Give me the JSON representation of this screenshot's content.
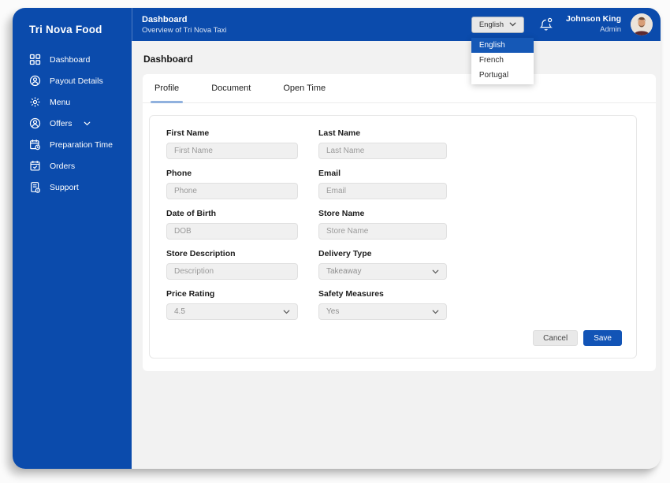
{
  "app": {
    "name": "Tri Nova Food"
  },
  "sidebar": {
    "items": [
      {
        "icon": "grid-icon",
        "label": "Dashboard"
      },
      {
        "icon": "user-circle-icon",
        "label": "Payout Details"
      },
      {
        "icon": "gear-icon",
        "label": "Menu"
      },
      {
        "icon": "user-circle-icon",
        "label": "Offers",
        "has_submenu": true
      },
      {
        "icon": "calendar-clock-icon",
        "label": "Preparation Time"
      },
      {
        "icon": "calendar-check-icon",
        "label": "Orders"
      },
      {
        "icon": "support-doc-icon",
        "label": "Support"
      }
    ]
  },
  "header": {
    "title": "Dashboard",
    "subtitle": "Overview of Tri Nova Taxi",
    "language": {
      "selected": "English",
      "options": [
        "English",
        "French",
        "Portugal"
      ],
      "active_option": "English"
    },
    "notifications_icon": "bell-icon",
    "user": {
      "name": "Johnson King",
      "role": "Admin"
    }
  },
  "main": {
    "heading": "Dashboard",
    "tabs": [
      {
        "label": "Profile",
        "active": true
      },
      {
        "label": "Document",
        "active": false
      },
      {
        "label": "Open Time",
        "active": false
      }
    ],
    "form": {
      "fields": [
        {
          "label": "First Name",
          "type": "input",
          "placeholder": "First Name"
        },
        {
          "label": "Last Name",
          "type": "input",
          "placeholder": "Last Name"
        },
        {
          "label": "Phone",
          "type": "input",
          "placeholder": "Phone"
        },
        {
          "label": "Email",
          "type": "input",
          "placeholder": "Email"
        },
        {
          "label": "Date of Birth",
          "type": "input",
          "placeholder": "DOB"
        },
        {
          "label": "Store Name",
          "type": "input",
          "placeholder": "Store Name"
        },
        {
          "label": "Store Description",
          "type": "input",
          "placeholder": "Description"
        },
        {
          "label": "Delivery Type",
          "type": "select",
          "value": "Takeaway"
        },
        {
          "label": "Price Rating",
          "type": "select",
          "value": "4.5"
        },
        {
          "label": "Safety Measures",
          "type": "select",
          "value": "Yes"
        }
      ],
      "buttons": {
        "cancel": "Cancel",
        "save": "Save"
      }
    }
  },
  "colors": {
    "primary_blue": "#0b4bac",
    "dropdown_active_blue": "#1558b6",
    "save_button_blue": "#1254b6",
    "tab_underline": "#90b1de",
    "content_background": "#f2f2f2",
    "input_background": "#f0f0f0"
  }
}
